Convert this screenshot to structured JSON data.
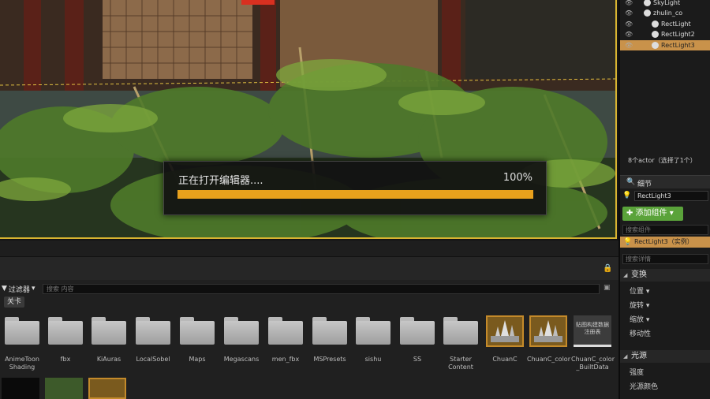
{
  "loading": {
    "message": "正在打开编辑器....",
    "percent_label": "100%",
    "progress": 1.0
  },
  "content_browser": {
    "filter_label": "过滤器",
    "search_placeholder": "搜索 内容",
    "tag": "关卡",
    "assets": [
      {
        "label": "AnimeToon Shading",
        "kind": "folder"
      },
      {
        "label": "fbx",
        "kind": "folder"
      },
      {
        "label": "KiAuras",
        "kind": "folder"
      },
      {
        "label": "LocalSobel",
        "kind": "folder"
      },
      {
        "label": "Maps",
        "kind": "folder"
      },
      {
        "label": "Megascans",
        "kind": "folder"
      },
      {
        "label": "men_fbx",
        "kind": "folder"
      },
      {
        "label": "MSPresets",
        "kind": "folder"
      },
      {
        "label": "sishu",
        "kind": "folder"
      },
      {
        "label": "SS",
        "kind": "folder"
      },
      {
        "label": "Starter Content",
        "kind": "folder"
      },
      {
        "label": "ChuanC",
        "kind": "texture"
      },
      {
        "label": "ChuanC_color",
        "kind": "texture"
      },
      {
        "label": "ChuanC_color _BuiltData",
        "kind": "built",
        "thumb_text": "贴图构建数据注册表"
      }
    ]
  },
  "outliner": {
    "items": [
      {
        "label": "SkyLight",
        "indent": 1
      },
      {
        "label": "zhulin_co",
        "indent": 1
      },
      {
        "label": "RectLight",
        "indent": 2
      },
      {
        "label": "RectLight2",
        "indent": 2
      },
      {
        "label": "RectLight3",
        "indent": 2,
        "selected": true
      }
    ],
    "actor_count": "8个actor（选择了1个）"
  },
  "details": {
    "tab_title": "细节",
    "actor_name": "RectLight3",
    "add_component_label": "✚ 添加组件 ▾",
    "component_search_placeholder": "搜索组件",
    "component_row": "RectLight3（实例）",
    "details_search_placeholder": "搜索详情",
    "sections": [
      {
        "title": "变换",
        "props": [
          "位置 ▾",
          "旋转 ▾",
          "缩放 ▾",
          "移动性"
        ]
      },
      {
        "title": "光源",
        "props": [
          "强度",
          "光源颜色"
        ]
      }
    ]
  },
  "colors": {
    "accent": "#e8a11c",
    "selection": "#c9924a",
    "add_button": "#5aa33a"
  }
}
